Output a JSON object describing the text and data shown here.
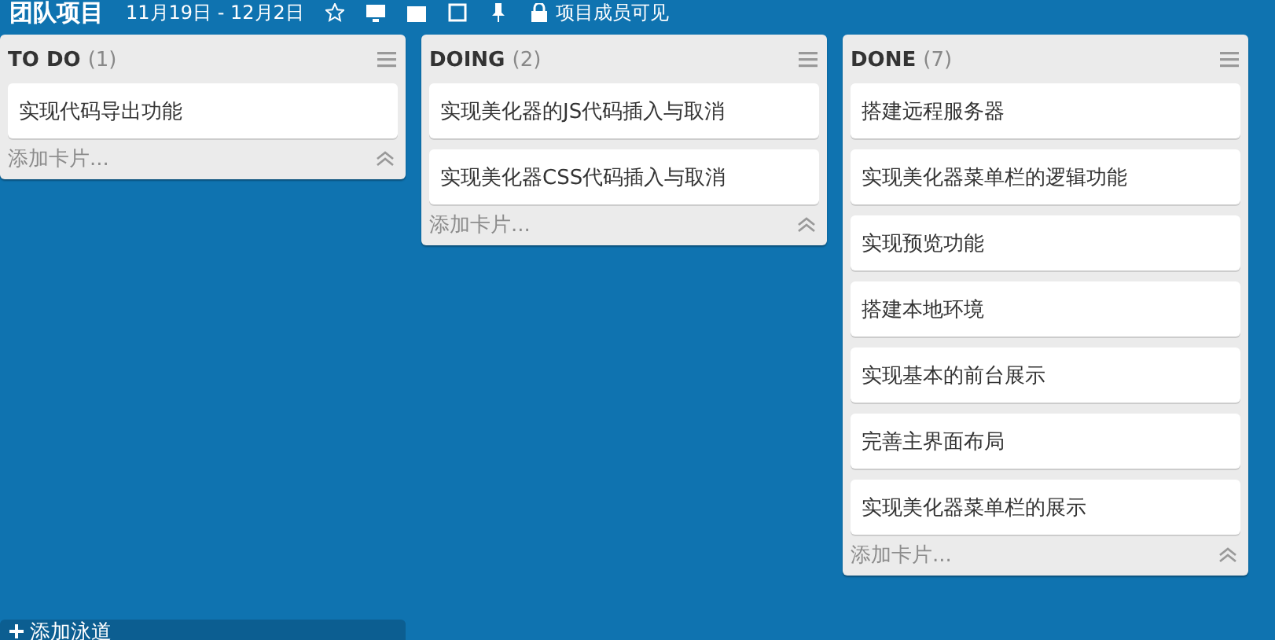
{
  "board": {
    "title": "团队项目",
    "dates": "11月19日 - 12月2日",
    "visibility": "项目成员可见"
  },
  "lists": [
    {
      "name": "TO DO",
      "count": "(1)",
      "cards": [
        "实现代码导出功能"
      ],
      "add_card": "添加卡片..."
    },
    {
      "name": "DOING",
      "count": "(2)",
      "cards": [
        "实现美化器的JS代码插入与取消",
        "实现美化器CSS代码插入与取消"
      ],
      "add_card": "添加卡片..."
    },
    {
      "name": "DONE",
      "count": "(7)",
      "cards": [
        "搭建远程服务器",
        "实现美化器菜单栏的逻辑功能",
        "实现预览功能",
        "搭建本地环境",
        "实现基本的前台展示",
        "完善主界面布局",
        "实现美化器菜单栏的展示"
      ],
      "add_card": "添加卡片..."
    }
  ],
  "add_lane": "添加泳道"
}
